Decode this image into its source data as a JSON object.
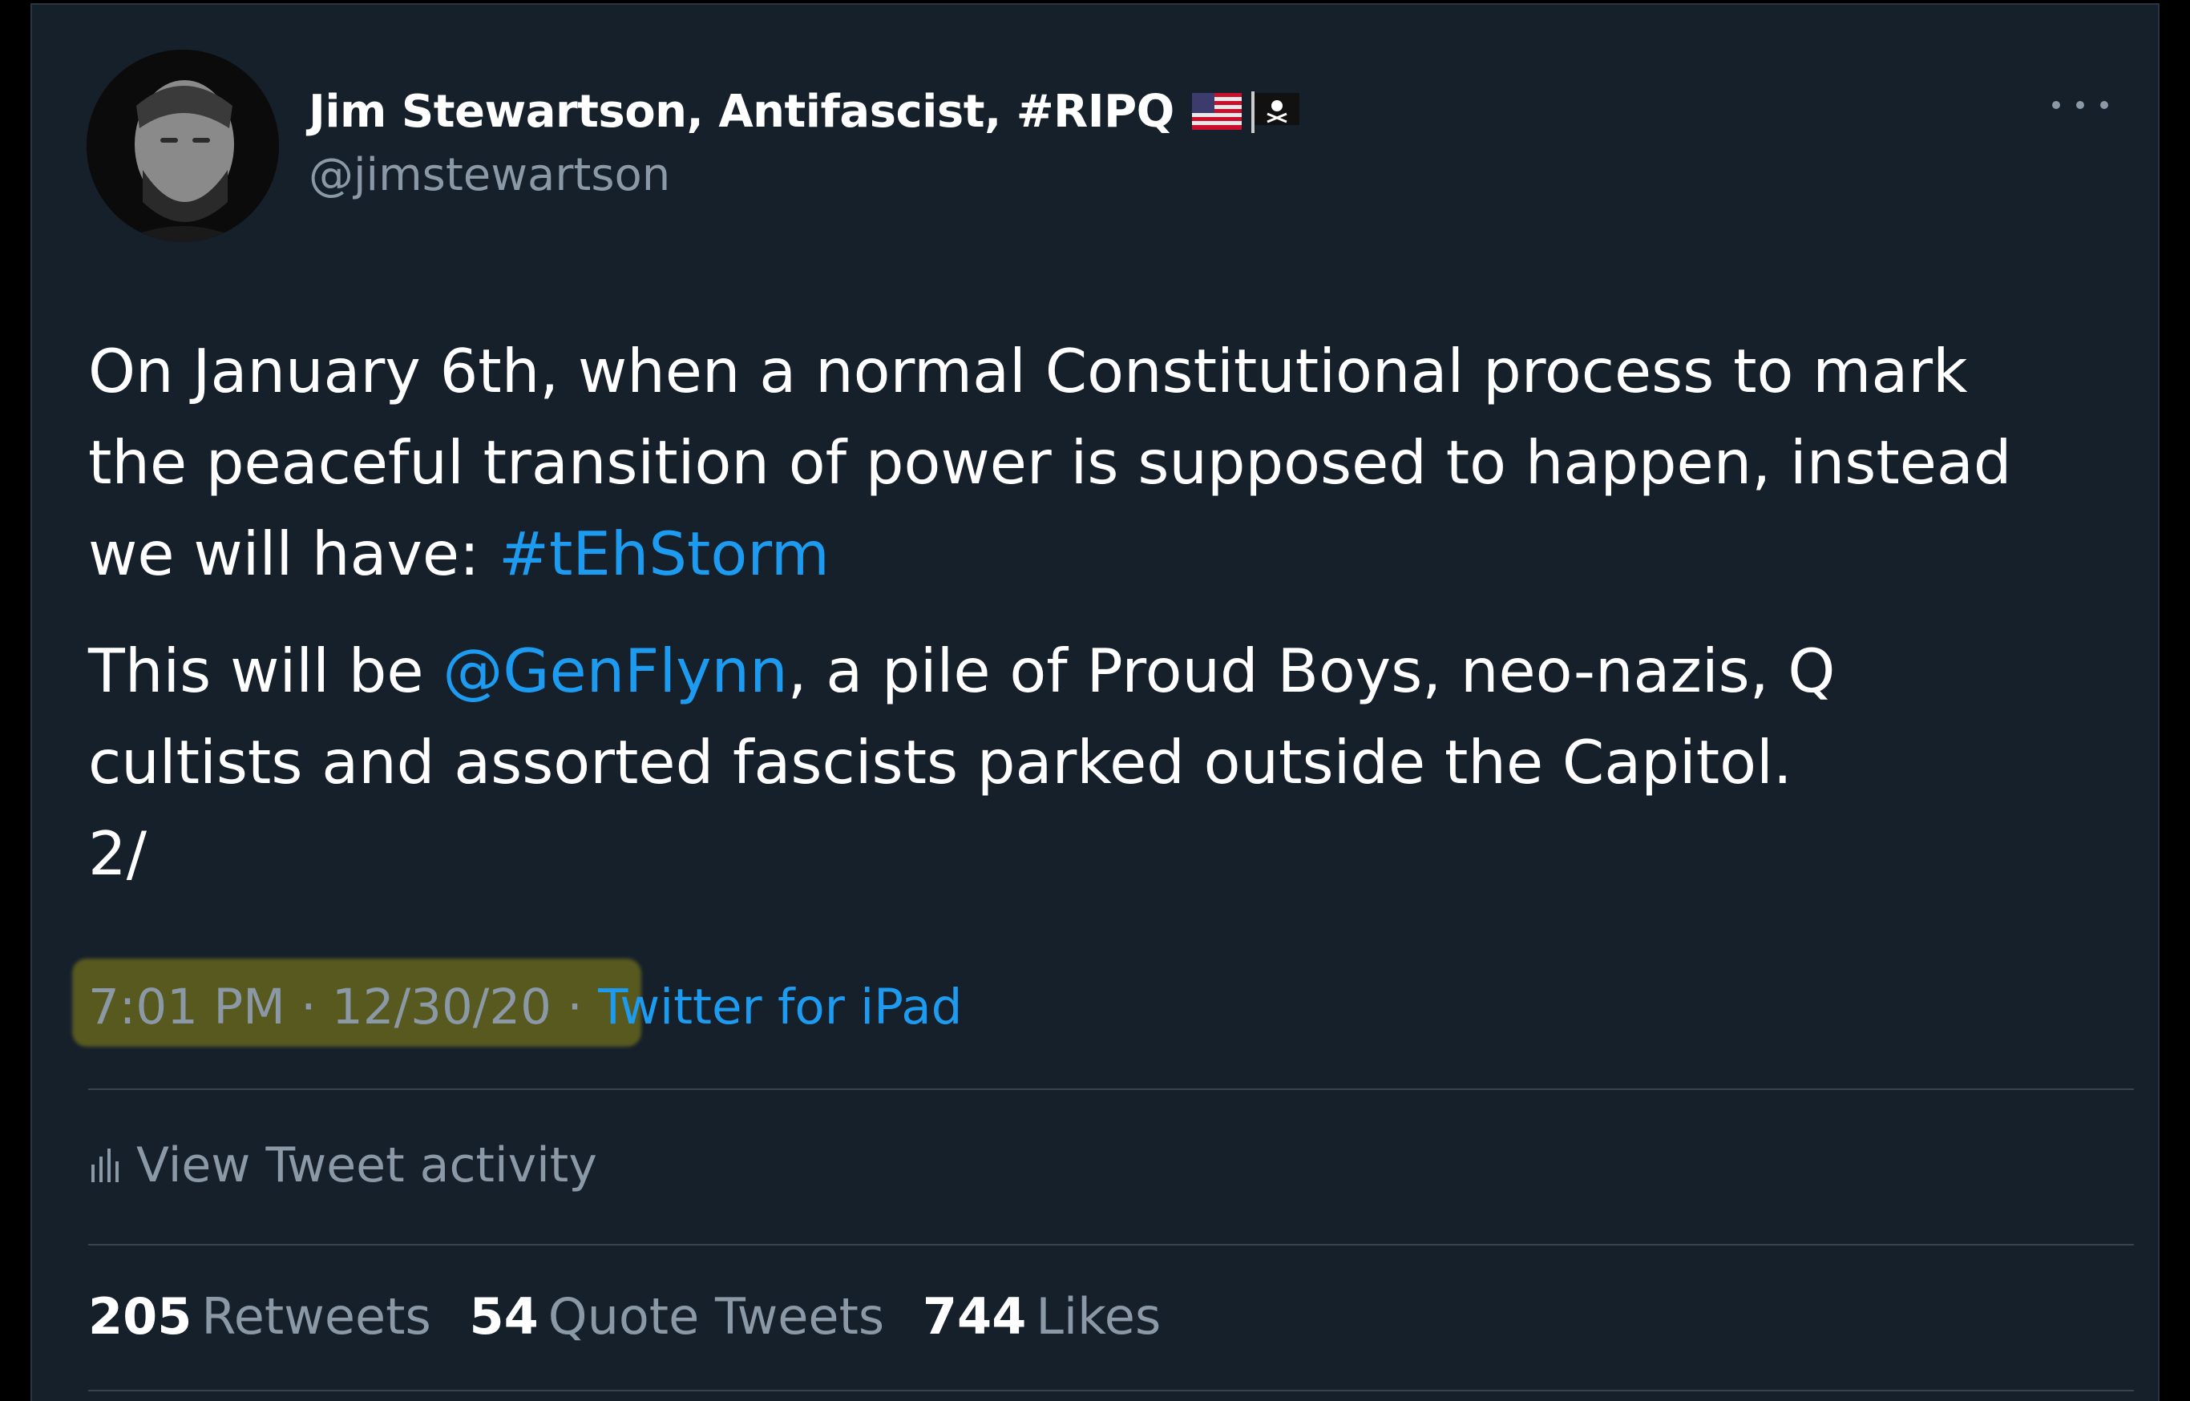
{
  "author": {
    "display_name": "Jim Stewartson, Antifascist, #RIPQ",
    "handle": "@jimstewartson",
    "badge_icons": [
      "us-flag-icon",
      "pirate-flag-icon"
    ]
  },
  "tweet": {
    "para1_line1": "On January 6th, when a normal Constitutional process to mark",
    "para1_line2": "the peaceful transition of power is supposed to happen, instead",
    "para1_line3_prefix": "we will have: ",
    "hashtag": "#tEhStorm",
    "para2_line1_prefix": "This will be ",
    "mention": "@GenFlynn",
    "para2_line1_suffix": ", a pile of Proud Boys, neo-nazis, Q",
    "para2_line2": "cultists and assorted fascists parked outside the Capitol.",
    "para2_line3": "2/"
  },
  "meta": {
    "time": "7:01 PM",
    "separator": " · ",
    "date": "12/30/20",
    "source": "Twitter for iPad"
  },
  "activity": {
    "label": "View Tweet activity"
  },
  "stats": {
    "retweets_count": "205",
    "retweets_label": "Retweets",
    "quotes_count": "54",
    "quotes_label": "Quote Tweets",
    "likes_count": "744",
    "likes_label": "Likes"
  },
  "colors": {
    "background": "#15202b",
    "text": "#ffffff",
    "secondary_text": "#8b98a5",
    "link": "#1d9bf0",
    "divider": "#38444d",
    "highlight": "#5f5f1e"
  }
}
